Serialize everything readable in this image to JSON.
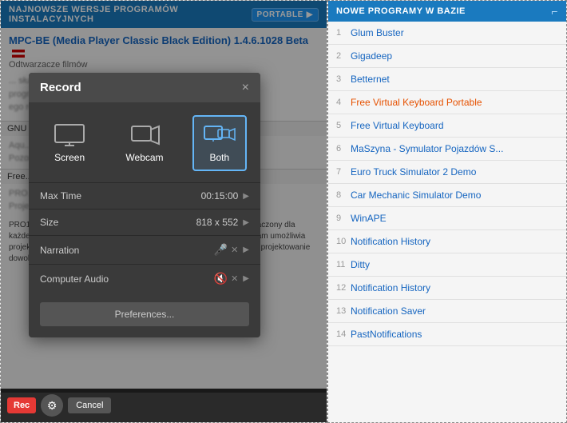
{
  "left_panel": {
    "top_bar_text": "NAJNOWSZE WERSJE PROGRAMÓW INSTALACYJNYCH",
    "portable_label": "PORTABLE",
    "app_title": "MPC-BE (Media Player Classic Black Edition) 1.4.6.1028 Beta",
    "app_category": "Odtwarzacze filmów",
    "blurred_text_1": "... służący do ... narzędziach, a ... programów. ... ego rozwojowe",
    "section_gnu": "GNU ...",
    "section_aqu": "Aqu... Pozos...",
    "section_free": "Free...",
    "section_pro": "PRO... Proje...",
    "pro100_text": "PRO100 - program do projektowania mebli i aranżacji wnętrz... przeznaczony dla każdego przedsiębiorcy działającego w szeroko pojętej ... rskiej. Program umożliwia projektowanie mebli \"od zera\" ... specyfikacje produkcyjne, pozwala na projektowanie dowolnych wnętrz (kuchnie, salony, łazienki, biura...) przy pom..."
  },
  "record_dialog": {
    "title": "Record",
    "close_label": "×",
    "options": [
      {
        "id": "screen",
        "label": "Screen",
        "active": false
      },
      {
        "id": "webcam",
        "label": "Webcam",
        "active": false
      },
      {
        "id": "both",
        "label": "Both",
        "active": true
      }
    ],
    "settings": [
      {
        "label": "Max Time",
        "value": "00:15:00",
        "has_arrow": true
      },
      {
        "label": "Size",
        "value": "818 x 552",
        "has_arrow": true
      },
      {
        "label": "Narration",
        "value": "",
        "has_icons": true
      },
      {
        "label": "Computer Audio",
        "value": "",
        "has_icons": true,
        "muted": true
      }
    ],
    "preferences_label": "Preferences..."
  },
  "bottom_bar": {
    "rec_label": "Rec",
    "cancel_label": "Cancel"
  },
  "right_panel": {
    "top_bar_text": "NOWE PROGRAMY W BAZIE",
    "programs": [
      {
        "num": "1",
        "name": "Glum Buster",
        "highlight": false
      },
      {
        "num": "2",
        "name": "Gigadeep",
        "highlight": false
      },
      {
        "num": "3",
        "name": "Betternet",
        "highlight": false
      },
      {
        "num": "4",
        "name": "Free Virtual Keyboard Portable",
        "highlight": true
      },
      {
        "num": "5",
        "name": "Free Virtual Keyboard",
        "highlight": false
      },
      {
        "num": "6",
        "name": "MaSzyna - Symulator Pojazdów S...",
        "highlight": false
      },
      {
        "num": "7",
        "name": "Euro Truck Simulator 2 Demo",
        "highlight": false
      },
      {
        "num": "8",
        "name": "Car Mechanic Simulator Demo",
        "highlight": false
      },
      {
        "num": "9",
        "name": "WinAPE",
        "highlight": false
      },
      {
        "num": "10",
        "name": "Notification History",
        "highlight": false
      },
      {
        "num": "11",
        "name": "Ditty",
        "highlight": false
      },
      {
        "num": "12",
        "name": "Notification History",
        "highlight": false
      },
      {
        "num": "13",
        "name": "Notification Saver",
        "highlight": false
      },
      {
        "num": "14",
        "name": "PastNotifications",
        "highlight": false
      }
    ]
  }
}
